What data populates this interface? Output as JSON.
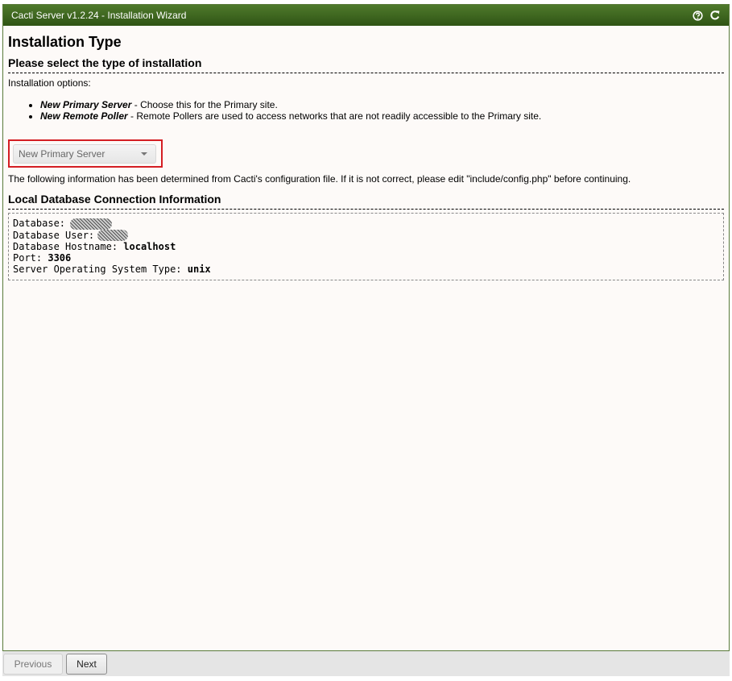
{
  "window": {
    "title": "Cacti Server v1.2.24 - Installation Wizard",
    "icons": [
      "help-icon",
      "refresh-icon"
    ]
  },
  "page": {
    "heading": "Installation Type",
    "section_title": "Please select the type of installation",
    "intro": "Installation options:",
    "options": [
      {
        "name": "New Primary Server",
        "desc": " - Choose this for the Primary site."
      },
      {
        "name": "New Remote Poller",
        "desc": " - Remote Pollers are used to access networks that are not readily accessible to the Primary site."
      }
    ],
    "select": {
      "selected": "New Primary Server"
    },
    "note": "The following information has been determined from Cacti's configuration file. If it is not correct, please edit \"include/config.php\" before continuing."
  },
  "db": {
    "title": "Local Database Connection Information",
    "rows": [
      {
        "label": "Database:",
        "value": ""
      },
      {
        "label": "Database User:",
        "value": ""
      },
      {
        "label": "Database Hostname:",
        "value": "localhost"
      },
      {
        "label": "Port:",
        "value": "3306"
      },
      {
        "label": "Server Operating System Type:",
        "value": "unix"
      }
    ]
  },
  "footer": {
    "previous": "Previous",
    "next": "Next"
  },
  "colors": {
    "titlebar": "#3f6820",
    "highlight": "#d41e23"
  }
}
